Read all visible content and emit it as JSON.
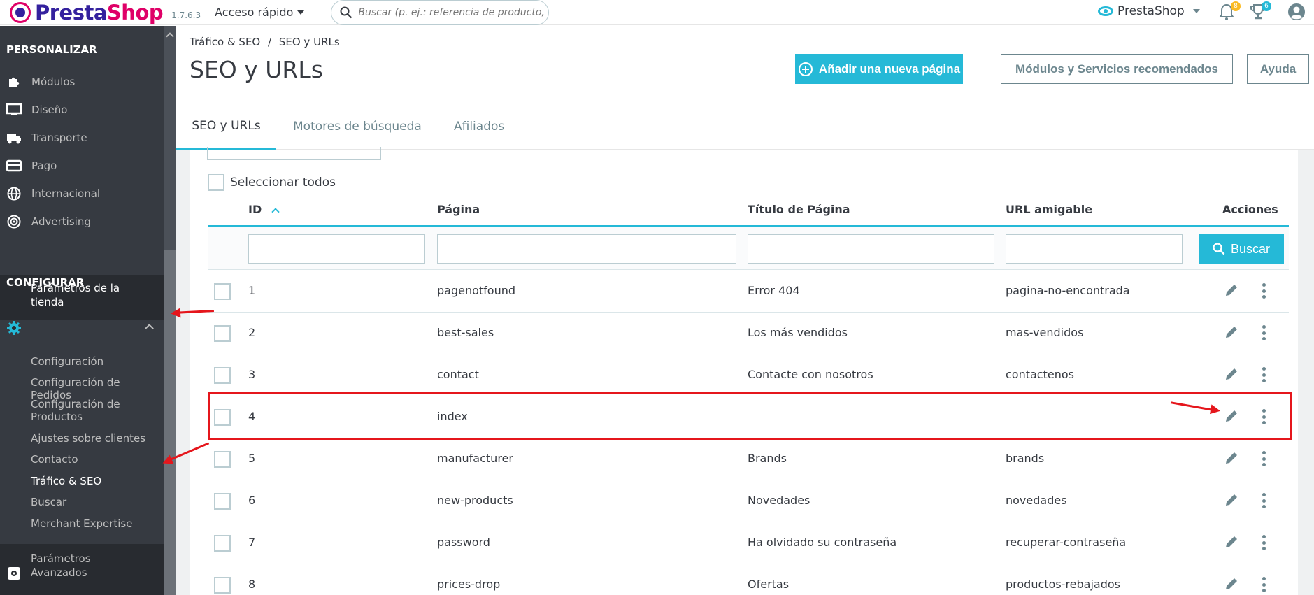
{
  "topbar": {
    "logo_text_1": "Presta",
    "logo_text_2": "Shop",
    "version": "1.7.6.3",
    "quick_access": "Acceso rápido",
    "search_placeholder": "Buscar (p. ej.: referencia de producto, nombre de cliente…)",
    "shop_name": "PrestaShop",
    "notifications_count": "8",
    "trophy_count": "6",
    "icons": [
      "eye-icon",
      "bell-icon",
      "trophy-icon",
      "user-icon"
    ]
  },
  "sidebar": {
    "section_personalize": "PERSONALIZAR",
    "personalize_items": [
      {
        "label": "Módulos",
        "icon": "puzzle-icon"
      },
      {
        "label": "Diseño",
        "icon": "monitor-icon"
      },
      {
        "label": "Transporte",
        "icon": "truck-icon"
      },
      {
        "label": "Pago",
        "icon": "credit-card-icon"
      },
      {
        "label": "Internacional",
        "icon": "globe-icon"
      },
      {
        "label": "Advertising",
        "icon": "target-icon"
      }
    ],
    "section_configure": "CONFIGURAR",
    "active_item": "Parámetros de la tienda",
    "sub_items": [
      "Configuración",
      "Configuración de Pedidos",
      "Configuración de Productos",
      "Ajustes sobre clientes",
      "Contacto",
      "Tráfico & SEO",
      "Buscar",
      "Merchant Expertise"
    ],
    "advanced_item": "Parámetros Avanzados"
  },
  "header": {
    "breadcrumb_parent": "Tráfico & SEO",
    "breadcrumb_separator": "/",
    "breadcrumb_current": "SEO y URLs",
    "title": "SEO y URLs",
    "add_page_label": "Añadir una nueva página",
    "modules_label": "Módulos y Servicios recomendados",
    "help_label": "Ayuda"
  },
  "tabs": [
    "SEO y URLs",
    "Motores de búsqueda",
    "Afiliados"
  ],
  "table": {
    "select_all": "Seleccionar todos",
    "columns": [
      "ID",
      "Página",
      "Título de Página",
      "URL amigable",
      "Acciones"
    ],
    "search_label": "Buscar",
    "rows": [
      {
        "id": "1",
        "page": "pagenotfound",
        "title": "Error 404",
        "url": "pagina-no-encontrada"
      },
      {
        "id": "2",
        "page": "best-sales",
        "title": "Los más vendidos",
        "url": "mas-vendidos"
      },
      {
        "id": "3",
        "page": "contact",
        "title": "Contacte con nosotros",
        "url": "contactenos"
      },
      {
        "id": "4",
        "page": "index",
        "title": "",
        "url": ""
      },
      {
        "id": "5",
        "page": "manufacturer",
        "title": "Brands",
        "url": "brands"
      },
      {
        "id": "6",
        "page": "new-products",
        "title": "Novedades",
        "url": "novedades"
      },
      {
        "id": "7",
        "page": "password",
        "title": "Ha olvidado su contraseña",
        "url": "recuperar-contraseña"
      },
      {
        "id": "8",
        "page": "prices-drop",
        "title": "Ofertas",
        "url": "productos-rebajados"
      }
    ]
  },
  "colors": {
    "accent": "#25b9d7",
    "sidebar_bg": "#363a41",
    "annotation_red": "#e5161c",
    "brand_pink": "#df0067",
    "brand_purple": "#34219e"
  }
}
